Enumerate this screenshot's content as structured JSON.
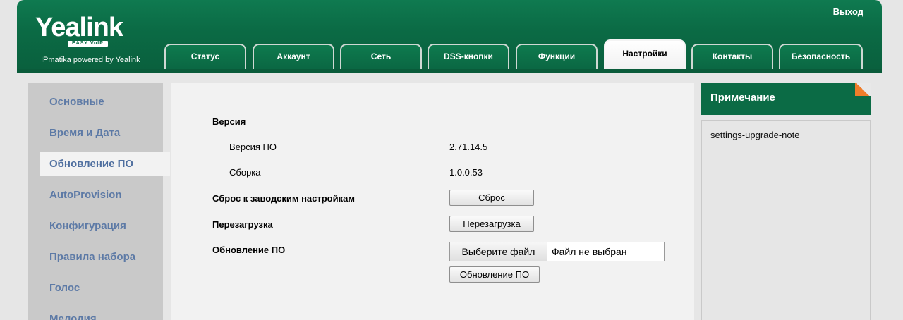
{
  "header": {
    "logo": "Yealink",
    "logo_sub": "EASY VoIP",
    "tagline": "IPmatika powered by Yealink",
    "logout": "Выход",
    "tabs": [
      {
        "label": "Статус"
      },
      {
        "label": "Аккаунт"
      },
      {
        "label": "Сеть"
      },
      {
        "label": "DSS-кнопки"
      },
      {
        "label": "Функции"
      },
      {
        "label": "Настройки"
      },
      {
        "label": "Контакты"
      },
      {
        "label": "Безопасность"
      }
    ],
    "active_tab": "Настройки"
  },
  "sidebar": {
    "items": [
      {
        "label": "Основные"
      },
      {
        "label": "Время и Дата"
      },
      {
        "label": "Обновление ПО"
      },
      {
        "label": "AutoProvision"
      },
      {
        "label": "Конфигурация"
      },
      {
        "label": "Правила набора"
      },
      {
        "label": "Голос"
      },
      {
        "label": "Мелодия"
      }
    ],
    "active_item": "Обновление ПО"
  },
  "main": {
    "version_heading": "Версия",
    "fw_version_label": "Версия ПО",
    "fw_version_value": "2.71.14.5",
    "build_label": "Сборка",
    "build_value": "1.0.0.53",
    "reset_label": "Сброс к заводским настройкам",
    "reset_button": "Сброс",
    "reboot_label": "Перезагрузка",
    "reboot_button": "Перезагрузка",
    "upgrade_label": "Обновление ПО",
    "choose_file_button": "Выберите файл",
    "no_file_text": "Файл не выбран",
    "upgrade_button": "Обновление ПО"
  },
  "note": {
    "title": "Примечание",
    "body": "settings-upgrade-note"
  },
  "colors": {
    "brand_green": "#0b6b45",
    "sidebar_text": "#5d7aa6",
    "note_corner": "#ef7d2a"
  }
}
